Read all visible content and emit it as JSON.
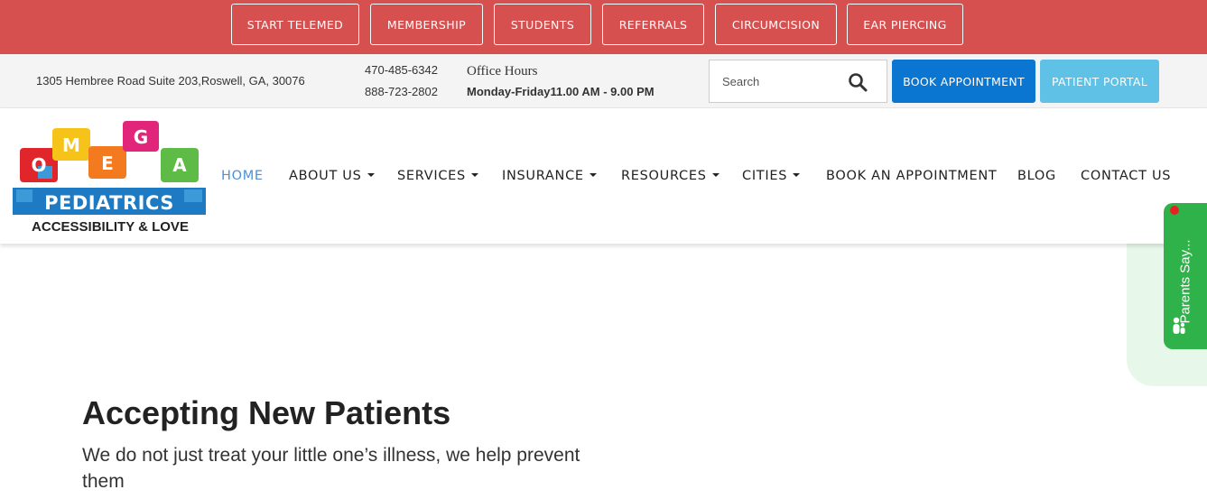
{
  "topbar": {
    "buttons": [
      "START TELEMED",
      "MEMBERSHIP",
      "STUDENTS",
      "REFERRALS",
      "CIRCUMCISION",
      "EAR PIERCING"
    ],
    "color": "#d65050"
  },
  "info": {
    "address": "1305 Hembree Road Suite 203,Roswell, GA, 30076",
    "phone1": "470-485-6342",
    "phone2": "888-723-2802",
    "hours_title": "Office Hours",
    "hours_value": "Monday-Friday11.00 AM - 9.00 PM",
    "search_placeholder": "Search",
    "search_icon": "search-icon",
    "book_label": "BOOK APPOINTMENT",
    "portal_label": "PATIENT PORTAL",
    "book_color": "#0b76d2",
    "portal_color": "#5fc1e6"
  },
  "logo": {
    "letters": [
      "O",
      "M",
      "E",
      "G",
      "A"
    ],
    "name": "PEDIATRICS",
    "tagline": "ACCESSIBILITY & LOVE"
  },
  "nav": {
    "items": [
      {
        "label": "HOME",
        "active": true,
        "dropdown": false
      },
      {
        "label": "ABOUT US",
        "active": false,
        "dropdown": true
      },
      {
        "label": "SERVICES",
        "active": false,
        "dropdown": true
      },
      {
        "label": "INSURANCE",
        "active": false,
        "dropdown": true
      },
      {
        "label": "RESOURCES",
        "active": false,
        "dropdown": true
      },
      {
        "label": "CITIES",
        "active": false,
        "dropdown": true
      },
      {
        "label": "BOOK AN APPOINTMENT",
        "active": false,
        "dropdown": false
      },
      {
        "label": "BLOG",
        "active": false,
        "dropdown": false
      },
      {
        "label": "CONTACT US",
        "active": false,
        "dropdown": false
      }
    ],
    "active_color": "#4a90d9"
  },
  "widget": {
    "label": "Parents Say...",
    "color": "#30b24a"
  },
  "hero": {
    "title": "Accepting New Patients",
    "subtitle": "We do not just treat your little one’s illness, we help prevent them"
  }
}
